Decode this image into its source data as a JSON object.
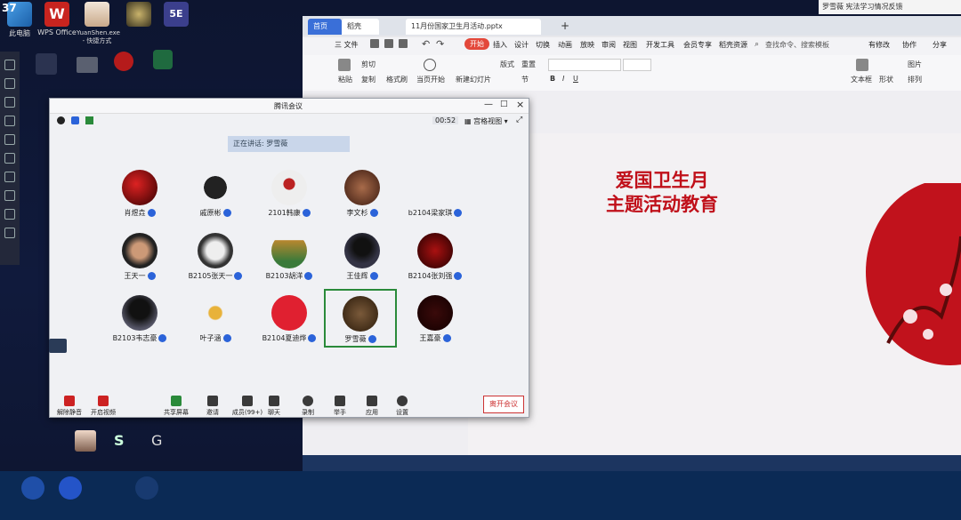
{
  "desktop": {
    "icons": [
      {
        "label": "此电脑"
      },
      {
        "label": "WPS Office"
      },
      {
        "label": "YuanShen.exe - 快捷方式"
      },
      {
        "label": ""
      },
      {
        "label": ""
      }
    ],
    "temp_badge": "37"
  },
  "notification": {
    "text": "罗雪薇 宪法学习情况反馈"
  },
  "wps": {
    "tabs": [
      {
        "label": "首页"
      },
      {
        "label": "稻壳"
      },
      {
        "label": "11月份国家卫生月活动.pptx"
      }
    ],
    "menu": [
      {
        "label": "三 文件"
      },
      {
        "label": "开始"
      },
      {
        "label": "插入"
      },
      {
        "label": "设计"
      },
      {
        "label": "切换"
      },
      {
        "label": "动画"
      },
      {
        "label": "放映"
      },
      {
        "label": "审阅"
      },
      {
        "label": "视图"
      },
      {
        "label": "开发工具"
      },
      {
        "label": "会员专享"
      },
      {
        "label": "稻壳资源"
      }
    ],
    "search_placeholder": "查找命令、搜索模板",
    "right_actions": [
      {
        "label": "有修改"
      },
      {
        "label": "协作"
      },
      {
        "label": "分享"
      }
    ],
    "ribbon": [
      {
        "label": "粘贴"
      },
      {
        "label": "剪切"
      },
      {
        "label": "复制"
      },
      {
        "label": "格式刷"
      },
      {
        "label": "当页开始"
      },
      {
        "label": "新建幻灯片"
      },
      {
        "label": "版式"
      },
      {
        "label": "节"
      },
      {
        "label": "重置"
      },
      {
        "label": "文本框"
      },
      {
        "label": "形状"
      },
      {
        "label": "图片"
      },
      {
        "label": "排列"
      }
    ],
    "slide": {
      "title_line1": "爱国卫生月",
      "title_line2": "主题活动教育"
    }
  },
  "meeting": {
    "title": "腾讯会议",
    "timer": "00:52",
    "view_label": "宫格视图",
    "speaking_label": "正在讲话: 罗雪薇",
    "participants": [
      {
        "name": "肖煜垚"
      },
      {
        "name": "戚原彬"
      },
      {
        "name": "2101韩康"
      },
      {
        "name": "李文杉"
      },
      {
        "name": "b2104梁家琪"
      },
      {
        "name": "王天一"
      },
      {
        "name": "B2105张天一"
      },
      {
        "name": "B2103胡洋"
      },
      {
        "name": "王佳辉"
      },
      {
        "name": "B2104张刘强"
      },
      {
        "name": "B2103韦志豪"
      },
      {
        "name": "叶子涵"
      },
      {
        "name": "B2104夏迪烨"
      },
      {
        "name": "罗雪薇"
      },
      {
        "name": "王嘉豪"
      }
    ],
    "bottom_buttons": [
      {
        "label": "解除静音"
      },
      {
        "label": "开启视频"
      },
      {
        "label": "共享屏幕"
      },
      {
        "label": "邀请"
      },
      {
        "label": "成员(99+)"
      },
      {
        "label": "聊天"
      },
      {
        "label": "录制"
      },
      {
        "label": "举手"
      },
      {
        "label": "应用"
      },
      {
        "label": "设置"
      }
    ],
    "leave_label": "离开会议"
  },
  "colors": {
    "slide_title": "#c0101a",
    "active_border": "#2a8a3a",
    "mic_blue": "#2b63d9",
    "leave_red": "#cc3333"
  }
}
